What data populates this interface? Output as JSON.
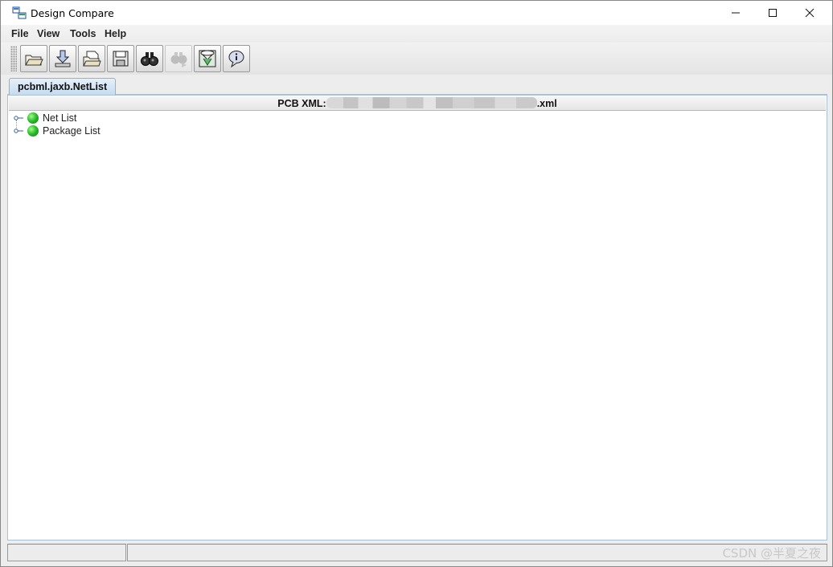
{
  "window": {
    "title": "Design Compare"
  },
  "menu": [
    "File",
    "View",
    "Tools",
    "Help"
  ],
  "toolbar": {
    "buttons": [
      {
        "icon": "open-folder-icon",
        "enabled": true
      },
      {
        "icon": "download-icon",
        "enabled": true
      },
      {
        "icon": "open-file-icon",
        "enabled": true
      },
      {
        "icon": "save-icon",
        "enabled": true
      },
      {
        "icon": "binoculars-icon",
        "enabled": true
      },
      {
        "icon": "find-next-icon",
        "enabled": false
      },
      {
        "icon": "compare-icon",
        "enabled": true
      },
      {
        "icon": "info-bubble-icon",
        "enabled": true
      }
    ]
  },
  "tab": {
    "label": "pcbml.jaxb.NetList"
  },
  "panel": {
    "header_prefix": "PCB XML:",
    "header_suffix": ".xml"
  },
  "tree": {
    "items": [
      "Net List",
      "Package List"
    ]
  },
  "watermark": "CSDN @半夏之夜",
  "colors": {
    "tab_bg": "#c6dbf0",
    "node_green": "#2fbf2f",
    "border_blue": "#a8c0d8"
  }
}
